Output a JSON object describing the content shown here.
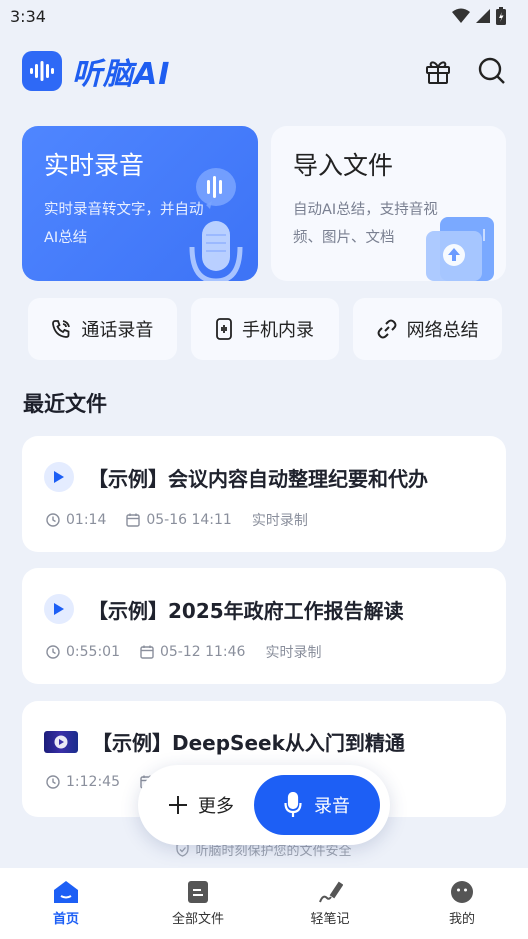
{
  "status": {
    "time": "3:34"
  },
  "header": {
    "brand": "听脑AI",
    "logo_icon": "waveform-logo-icon"
  },
  "cards": {
    "realtime": {
      "title": "实时录音",
      "desc": "实时录音转文字，并自动AI总结"
    },
    "import": {
      "title": "导入文件",
      "desc": "自动AI总结，支持音视频、图片、文档"
    }
  },
  "quick_actions": [
    {
      "label": "通话录音",
      "icon": "phone-icon"
    },
    {
      "label": "手机内录",
      "icon": "phone-record-icon"
    },
    {
      "label": "网络总结",
      "icon": "link-icon"
    }
  ],
  "recent": {
    "title": "最近文件",
    "files": [
      {
        "title": "【示例】会议内容自动整理纪要和代办",
        "duration": "01:14",
        "date": "05-16 14:11",
        "source": "实时录制",
        "kind": "audio"
      },
      {
        "title": "【示例】2025年政府工作报告解读",
        "duration": "0:55:01",
        "date": "05-12 11:46",
        "source": "实时录制",
        "kind": "audio"
      },
      {
        "title": "【示例】DeepSeek从入门到精通",
        "duration": "1:12:45",
        "date": "",
        "source": "",
        "kind": "video"
      }
    ]
  },
  "fab": {
    "more": "更多",
    "record": "录音"
  },
  "privacy_note": "听脑时刻保护您的文件安全",
  "nav": [
    {
      "label": "首页",
      "active": true
    },
    {
      "label": "全部文件",
      "active": false
    },
    {
      "label": "轻笔记",
      "active": false
    },
    {
      "label": "我的",
      "active": false
    }
  ],
  "colors": {
    "accent": "#1d5ff5",
    "card_blue": "#4f86ff",
    "background": "#edf1f9"
  }
}
